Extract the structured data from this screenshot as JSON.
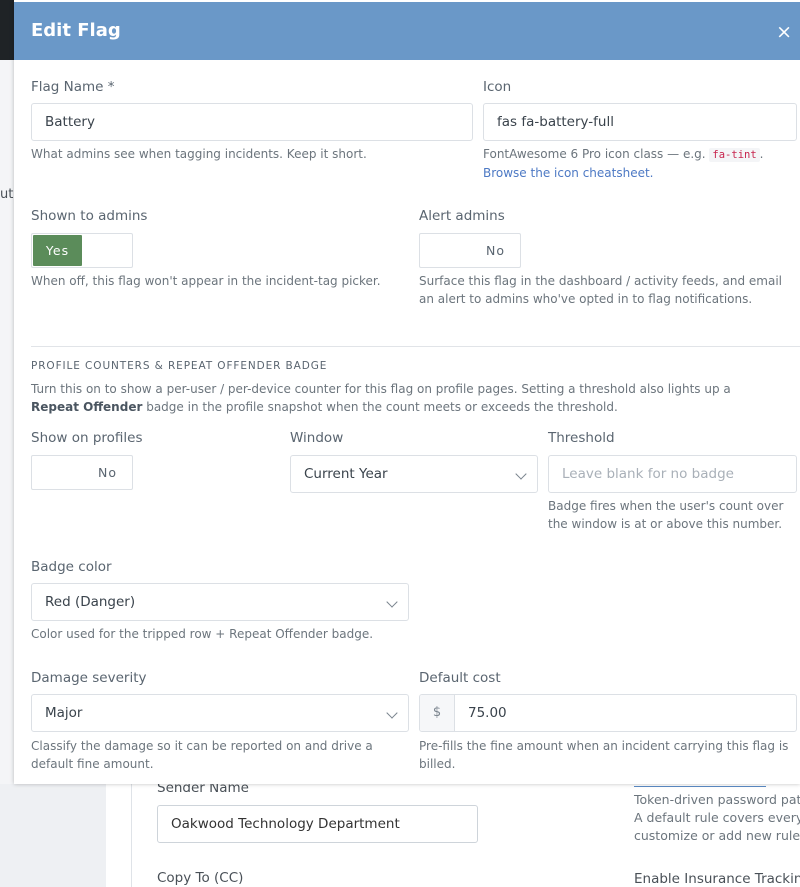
{
  "background": {
    "partial_word": "ut",
    "sender_name_label": "Sender Name",
    "sender_name_value": "Oakwood Technology Department",
    "copy_to_label": "Copy To (CC)",
    "right_help_1": "Token-driven password patt",
    "right_help_2": "A default rule covers every g",
    "right_help_3": "customize or add new rules f",
    "insurance_label": "Enable Insurance Trackin"
  },
  "modal": {
    "title": "Edit Flag",
    "close_glyph": "×",
    "flag_name": {
      "label": "Flag Name *",
      "value": "Battery",
      "help": "What admins see when tagging incidents. Keep it short."
    },
    "icon": {
      "label": "Icon",
      "value": "fas fa-battery-full",
      "help_prefix": "FontAwesome 6 Pro icon class — e.g.",
      "help_code": "fa-tint",
      "help_suffix": ".",
      "help_link": "Browse the icon cheatsheet."
    },
    "shown_to_admins": {
      "label": "Shown to admins",
      "state": "Yes",
      "help": "When off, this flag won't appear in the incident-tag picker."
    },
    "alert_admins": {
      "label": "Alert admins",
      "state": "No",
      "help": "Surface this flag in the dashboard / activity feeds, and email an alert to admins who've opted in to flag notifications."
    },
    "section": {
      "heading": "PROFILE COUNTERS & REPEAT OFFENDER BADGE",
      "desc_1": "Turn this on to show a per-user / per-device counter for this flag on profile pages. Setting a threshold also lights up a",
      "desc_bold": "Repeat Offender",
      "desc_2": "badge in the profile snapshot when the count meets or exceeds the threshold."
    },
    "show_on_profiles": {
      "label": "Show on profiles",
      "state": "No"
    },
    "window": {
      "label": "Window",
      "value": "Current Year"
    },
    "threshold": {
      "label": "Threshold",
      "placeholder": "Leave blank for no badge",
      "help": "Badge fires when the user's count over the window is at or above this number."
    },
    "badge_color": {
      "label": "Badge color",
      "value": "Red (Danger)",
      "help": "Color used for the tripped row + Repeat Offender badge."
    },
    "damage_severity": {
      "label": "Damage severity",
      "value": "Major",
      "help": "Classify the damage so it can be reported on and drive a default fine amount."
    },
    "default_cost": {
      "label": "Default cost",
      "currency": "$",
      "value": "75.00",
      "help": "Pre-fills the fine amount when an incident carrying this flag is billed."
    }
  },
  "colors": {
    "header": "#6a98c8",
    "toggle_on": "#5b8c5a",
    "link": "#4d79c4"
  }
}
